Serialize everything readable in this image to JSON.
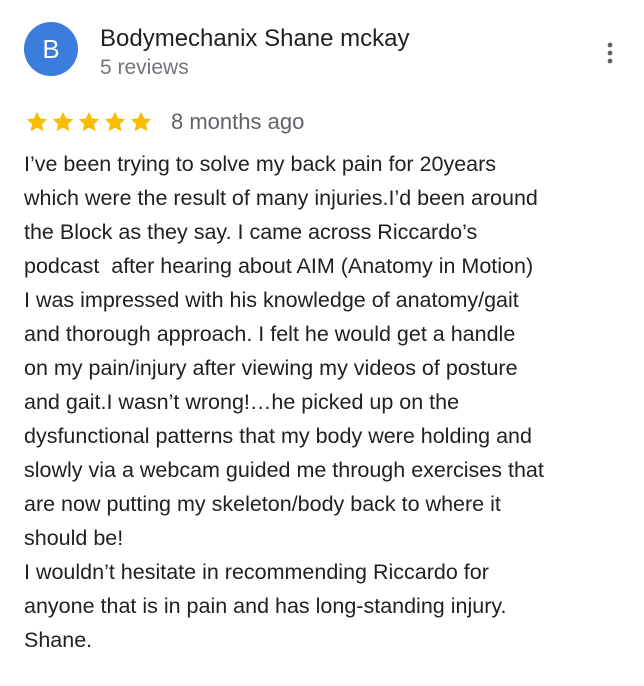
{
  "reviewer": {
    "avatar_letter": "B",
    "avatar_color": "#3b7ddd",
    "name": "Bodymechanix Shane mckay",
    "review_count": "5 reviews"
  },
  "menu": {
    "icon": "more-vert-icon"
  },
  "rating": {
    "stars": 5,
    "max": 5,
    "star_color": "#fbbc04",
    "date": "8 months ago"
  },
  "review_text_lines": [
    "I’ve been trying to solve my back pain for 20years",
    "which were the result of many injuries.I’d been around",
    "the Block as they say. I came across Riccardo’s",
    "podcast  after hearing about AIM (Anatomy in Motion)",
    "I was impressed with his knowledge of anatomy/gait",
    "and thorough approach. I felt he would get a handle",
    "on my pain/injury after viewing my videos of posture",
    "and gait.I wasn’t wrong!…he picked up on the",
    "dysfunctional patterns that my body were holding and",
    "slowly via a webcam guided me through exercises that",
    "are now putting my skeleton/body back to where it",
    "should be!",
    "I wouldn’t hesitate in recommending Riccardo for",
    "anyone that is in pain and has long-standing injury.",
    "Shane."
  ]
}
